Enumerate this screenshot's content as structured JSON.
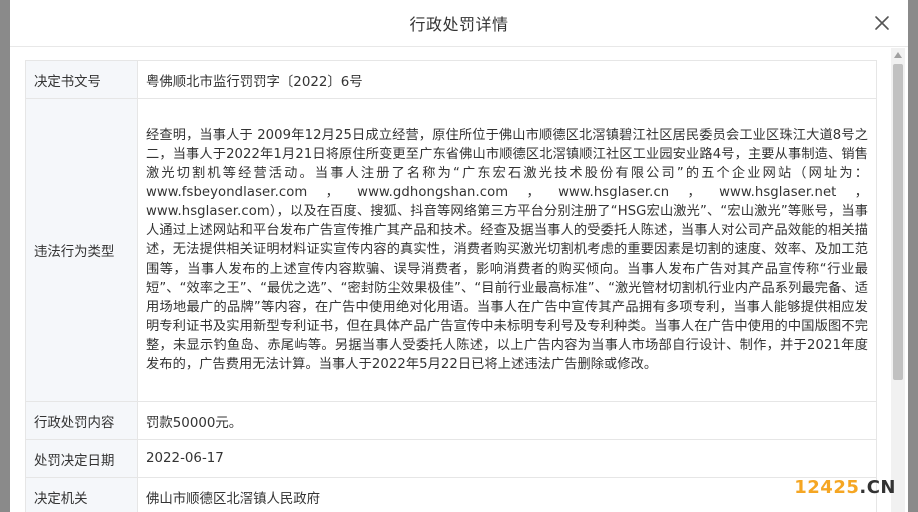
{
  "dialog": {
    "title": "行政处罚详情",
    "close_icon": "close-icon"
  },
  "rows": {
    "doc_no": {
      "label": "决定书文号",
      "value": "粤佛顺北市监行罚罚字〔2022〕6号"
    },
    "violation": {
      "label": "违法行为类型",
      "value": "经查明，当事人于 2009年12月25日成立经营，原住所位于佛山市顺德区北滘镇碧江社区居民委员会工业区珠江大道8号之二，当事人于2022年1月21日将原住所变更至广东省佛山市顺德区北滘镇顺江社区工业园安业路4号，主要从事制造、销售激光切割机等经营活动。当事人注册了名称为“广东宏石激光技术股份有限公司”的五个企业网站（网址为：www.fsbeyondlaser.com，www.gdhongshan.com，www.hsglaser.cn，www.hsglaser.net，www.hsglaser.com），以及在百度、搜狐、抖音等网络第三方平台分别注册了“HSG宏山激光”、“宏山激光”等账号，当事人通过上述网站和平台发布广告宣传推广其产品和技术。经查及据当事人的受委托人陈述，当事人对公司产品效能的相关描述，无法提供相关证明材料证实宣传内容的真实性，消费者购买激光切割机考虑的重要因素是切割的速度、效率、及加工范围等，当事人发布的上述宣传内容欺骗、误导消费者，影响消费者的购买倾向。当事人发布广告对其产品宣传称“行业最短”、“效率之王”、“最优之选”、“密封防尘效果极佳”、“目前行业最高标准”、“激光管材切割机行业内产品系列最完备、适用场地最广的品牌”等内容，在广告中使用绝对化用语。当事人在广告中宣传其产品拥有多项专利，当事人能够提供相应发明专利证书及实用新型专利证书，但在具体产品广告宣传中未标明专利号及专利种类。当事人在广告中使用的中国版图不完整，未显示钓鱼岛、赤尾屿等。另据当事人受委托人陈述，以上广告内容为当事人市场部自行设计、制作，并于2021年度发布的，广告费用无法计算。当事人于2022年5月22日已将上述违法广告删除或修改。"
    },
    "penalty_content": {
      "label": "行政处罚内容",
      "value": "罚款50000元。"
    },
    "decision_date": {
      "label": "处罚决定日期",
      "value": "2022-06-17"
    },
    "authority": {
      "label": "决定机关",
      "value": "佛山市顺德区北滘镇人民政府"
    }
  },
  "watermark": {
    "num": "12425",
    "dot": ".",
    "cn": "CN"
  },
  "colors": {
    "label_bg": "#f5f7fa",
    "border": "#e6e6e6",
    "watermark_orange": "#f5a623",
    "overlay": "#7a7a7a"
  }
}
